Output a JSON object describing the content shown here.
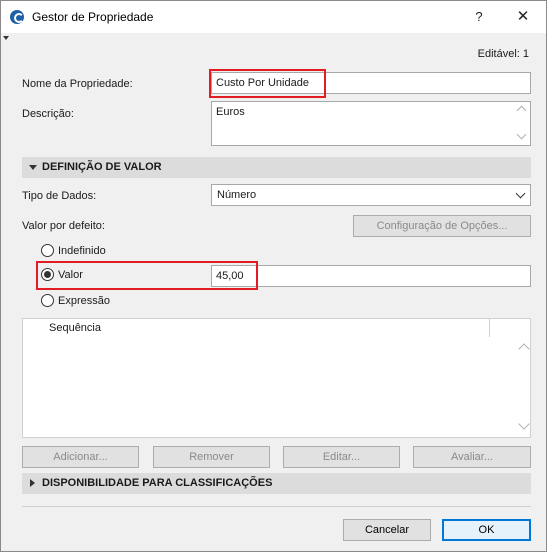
{
  "window": {
    "title": "Gestor de Propriedade",
    "help": "?",
    "close": "✕"
  },
  "editable": "Editável: 1",
  "property_name": {
    "label": "Nome da Propriedade:",
    "value": "Custo Por Unidade"
  },
  "description": {
    "label": "Descrição:",
    "value": "Euros"
  },
  "value_definition": {
    "header": "DEFINIÇÃO DE VALOR",
    "data_type_label": "Tipo de Dados:",
    "data_type_value": "Número",
    "default_label": "Valor por defeito:",
    "options_button": "Configuração de Opções...",
    "radios": [
      {
        "label": "Indefinido",
        "selected": false
      },
      {
        "label": "Valor",
        "selected": true
      },
      {
        "label": "Expressão",
        "selected": false
      }
    ],
    "value_field": "45,00",
    "list_header": "Sequência",
    "buttons": {
      "add": "Adicionar...",
      "remove": "Remover",
      "edit": "Editar...",
      "evaluate": "Avaliar..."
    }
  },
  "classifications": {
    "header": "DISPONIBILIDADE PARA CLASSIFICAÇÕES"
  },
  "footer": {
    "cancel": "Cancelar",
    "ok": "OK"
  },
  "colors": {
    "highlight": "#e31b23",
    "accent": "#0078d7",
    "section": "#dcdcdc"
  }
}
